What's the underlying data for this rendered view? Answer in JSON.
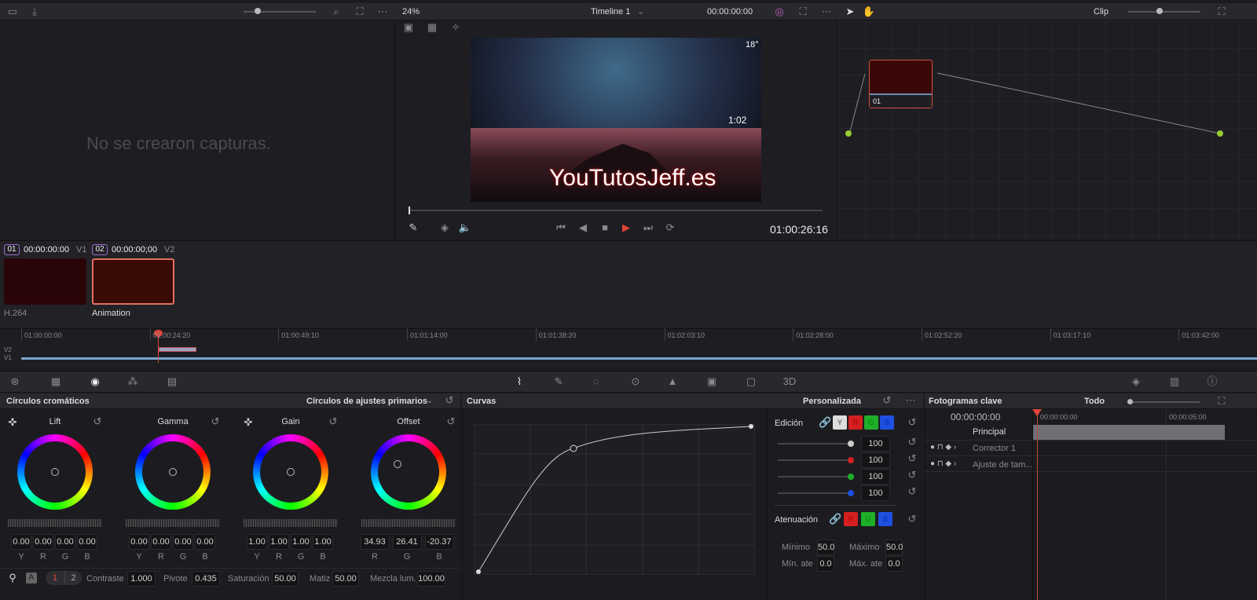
{
  "top_toolbar": {
    "zoom": "24%",
    "timeline_name": "Timeline 1",
    "timecode": "00:00:00:00",
    "node_mode": "Clip"
  },
  "gallery": {
    "empty_message": "No se crearon capturas."
  },
  "viewer": {
    "timecode": "01:00:26:16",
    "watermark": "YouTutosJeff.es",
    "clock": "1:02",
    "temp": "18°",
    "playhead_fraction": 0.0
  },
  "node": {
    "label": "01"
  },
  "clips": [
    {
      "number": "01",
      "timecode": "00:00:00:00",
      "track": "V1",
      "codec": "H.264",
      "color": "#2a0508"
    },
    {
      "number": "02",
      "timecode": "00:00:00;00",
      "track": "V2",
      "codec": "Animation",
      "color": "#3a0a06"
    }
  ],
  "timeline": {
    "ticks": [
      "01:00:00:00",
      "01:00:24:20",
      "01:00:49:10",
      "01:01:14:00",
      "01:01:38:20",
      "01:02:03:10",
      "01:02:28:00",
      "01:02:52:20",
      "01:03:17:10",
      "01:03:42:00"
    ],
    "tracks": [
      "V2",
      "V1"
    ]
  },
  "color_wheels": {
    "title": "Círculos cromáticos",
    "mode": "Círculos de ajustes primarios",
    "wheels": [
      {
        "name": "Lift",
        "values": [
          "0.00",
          "0.00",
          "0.00",
          "0.00"
        ],
        "channels": [
          "Y",
          "R",
          "G",
          "B"
        ]
      },
      {
        "name": "Gamma",
        "values": [
          "0.00",
          "0.00",
          "0.00",
          "0.00"
        ],
        "channels": [
          "Y",
          "R",
          "G",
          "B"
        ]
      },
      {
        "name": "Gain",
        "values": [
          "1.00",
          "1.00",
          "1.00",
          "1.00"
        ],
        "channels": [
          "Y",
          "R",
          "G",
          "B"
        ]
      },
      {
        "name": "Offset",
        "values": [
          "34.93",
          "26.41",
          "-20.37"
        ],
        "channels": [
          "R",
          "G",
          "B"
        ]
      }
    ],
    "footer": {
      "auto": "A",
      "page1": "1",
      "page2": "2",
      "contrast_label": "Contraste",
      "contrast": "1.000",
      "pivot_label": "Pivote",
      "pivot": "0.435",
      "sat_label": "Saturación",
      "sat": "50.00",
      "hue_label": "Matiz",
      "hue": "50.00",
      "lum_label": "Mezcla lum.",
      "lum": "100.00"
    }
  },
  "curves": {
    "title": "Curvas",
    "mode": "Personalizada",
    "edit_label": "Edición",
    "edit_channels": [
      "Y",
      "R",
      "G",
      "B"
    ],
    "intensity": [
      "100",
      "100",
      "100",
      "100"
    ],
    "soft_label": "Atenuación",
    "soft_channels": [
      "R",
      "G",
      "B"
    ],
    "min_label": "Mínimo",
    "min": "50.0",
    "max_label": "Máximo",
    "max": "50.0",
    "min_soft_label": "Mín. ate",
    "min_soft": "0.0",
    "max_soft_label": "Máx. ate",
    "max_soft": "0.0"
  },
  "keyframes": {
    "title": "Fotogramas clave",
    "filter": "Todo",
    "timecode": "00:00:00:00",
    "ruler": [
      "00:00:00:00",
      "00:00:05:00"
    ],
    "rows": [
      "Principal",
      "Corrector 1",
      "Ajuste de tam..."
    ]
  },
  "colors": {
    "accent_red": "#e0463a",
    "r": "#d42020",
    "g": "#1fae2a",
    "b": "#1f4fe0"
  }
}
